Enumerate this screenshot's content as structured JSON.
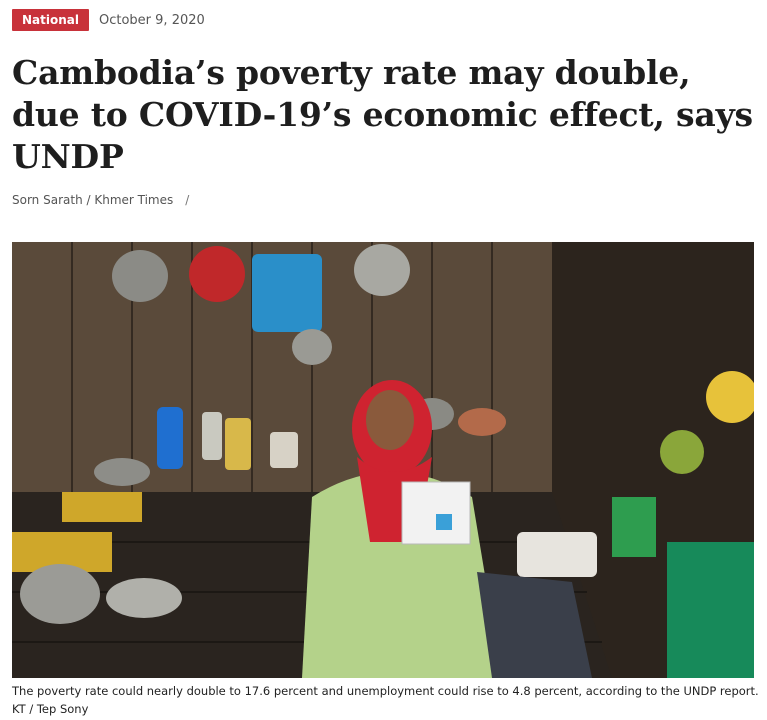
{
  "article": {
    "category": "National",
    "date": "October 9, 2020",
    "headline": "Cambodia’s poverty rate may double, due to COVID-19’s economic effect, says UNDP",
    "byline": {
      "author": "Sorn Sarath / Khmer Times",
      "separator": "/"
    },
    "caption": "The poverty rate could nearly double to 17.6 percent and unemployment could rise to 4.8 percent, according to the UNDP report.",
    "photo_credit": "KT / Tep Sony"
  },
  "colors": {
    "badge": "#c8323a",
    "headline": "#1e1e1e",
    "meta_text": "#555555"
  }
}
